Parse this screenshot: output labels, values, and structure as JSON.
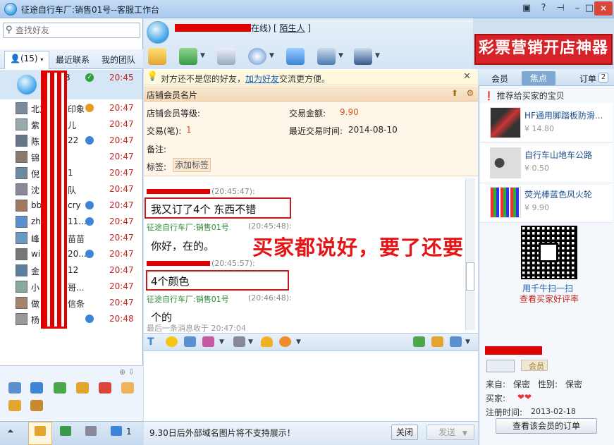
{
  "window": {
    "title": "征途自行车厂:销售01号--客服工作台"
  },
  "search": {
    "placeholder": "查找好友"
  },
  "left_tabs": {
    "count": "(15)",
    "recent": "最近联系",
    "team": "我的团队"
  },
  "contacts": [
    {
      "name": "3",
      "time": "20:45",
      "badge": "ok"
    },
    {
      "name": "北京",
      "name2": "印象",
      "time": "20:47",
      "badge": "o"
    },
    {
      "name": "紫",
      "name2": "儿",
      "time": "20:47"
    },
    {
      "name": "陈",
      "name2": "22",
      "time": "20:47",
      "badge": "b"
    },
    {
      "name": "锦",
      "name2": "",
      "time": "20:47"
    },
    {
      "name": "倪",
      "name2": "1",
      "time": "20:47"
    },
    {
      "name": "沈",
      "name2": "队",
      "time": "20:47"
    },
    {
      "name": "bb",
      "name2": "cry",
      "time": "20:47",
      "badge": "b"
    },
    {
      "name": "zh",
      "name2": "11...",
      "time": "20:47",
      "badge": "b"
    },
    {
      "name": "峰",
      "name2": "苗苗",
      "time": "20:47"
    },
    {
      "name": "win",
      "name2": "20...",
      "time": "20:47",
      "badge": "b"
    },
    {
      "name": "金",
      "name2": "12",
      "time": "20:47"
    },
    {
      "name": "小",
      "name2": "哥...",
      "time": "20:47"
    },
    {
      "name": "做",
      "name2": "信条",
      "time": "20:47"
    },
    {
      "name": "杨",
      "name2": "",
      "time": "20:48",
      "badge": "b"
    }
  ],
  "left_bottom": {
    "count": "1"
  },
  "chat_header": {
    "status": "在线)",
    "stranger": "陌生人",
    "ad": "彩票营销开店神器"
  },
  "notice": {
    "before": "对方还不是您的好友，",
    "link": "加为好友",
    "after": "交流更方便。"
  },
  "card": {
    "title": "店铺会员名片",
    "level_label": "店铺会员等级:",
    "amount_label": "交易金额:",
    "amount": "9.90",
    "count_label": "交易(笔):",
    "count": "1",
    "recent_label": "最近交易时间:",
    "recent": "2014-08-10",
    "note_label": "备注:",
    "tag_label": "标签:",
    "tag_button": "添加标签"
  },
  "chat": [
    {
      "sender": "",
      "time": "(20:45:47):",
      "text": "我又订了4个  东西不错"
    },
    {
      "sender": "征途自行车厂:销售01号",
      "time": "(20:45:48):",
      "text": "你好，在的。"
    },
    {
      "sender": "",
      "time": "(20:45:57):",
      "text": "4个颜色"
    },
    {
      "sender": "征途自行车厂:销售01号",
      "time": "(20:46:48):",
      "text": "个的"
    }
  ],
  "overlay": "买家都说好，要了还要",
  "last_msg": "最后一条消息收于 20:47:04",
  "bottom": {
    "tip": "9.30日后外部域名图片将不支持展示！",
    "close": "关闭",
    "send": "发送"
  },
  "right_tabs": {
    "member": "会员",
    "focus": "焦点",
    "order": "订单",
    "order_count": "2"
  },
  "recommend": {
    "header": "推荐给买家的宝贝"
  },
  "products": [
    {
      "name": "HF通用脚踏板防滑...",
      "price": "¥ 14.80"
    },
    {
      "name": "自行车山地车公路",
      "price": "¥ 0.50"
    },
    {
      "name": "荧光棒蓝色风火轮",
      "price": "¥ 9.90"
    }
  ],
  "qr": {
    "line1": "用千牛扫一扫",
    "line2": "查看买家好评率"
  },
  "buyer": {
    "vip": "会员",
    "from_label": "来自:",
    "from": "保密",
    "gender_label": "性别:",
    "gender": "保密",
    "buyer_label": "买家:",
    "reg_label": "注册时间:",
    "reg": "2013-02-18",
    "view_orders": "查看该会员的订单"
  },
  "colors": {
    "accent": "#3b84d6",
    "alert": "#c0261f",
    "highlight": "#e61414"
  }
}
